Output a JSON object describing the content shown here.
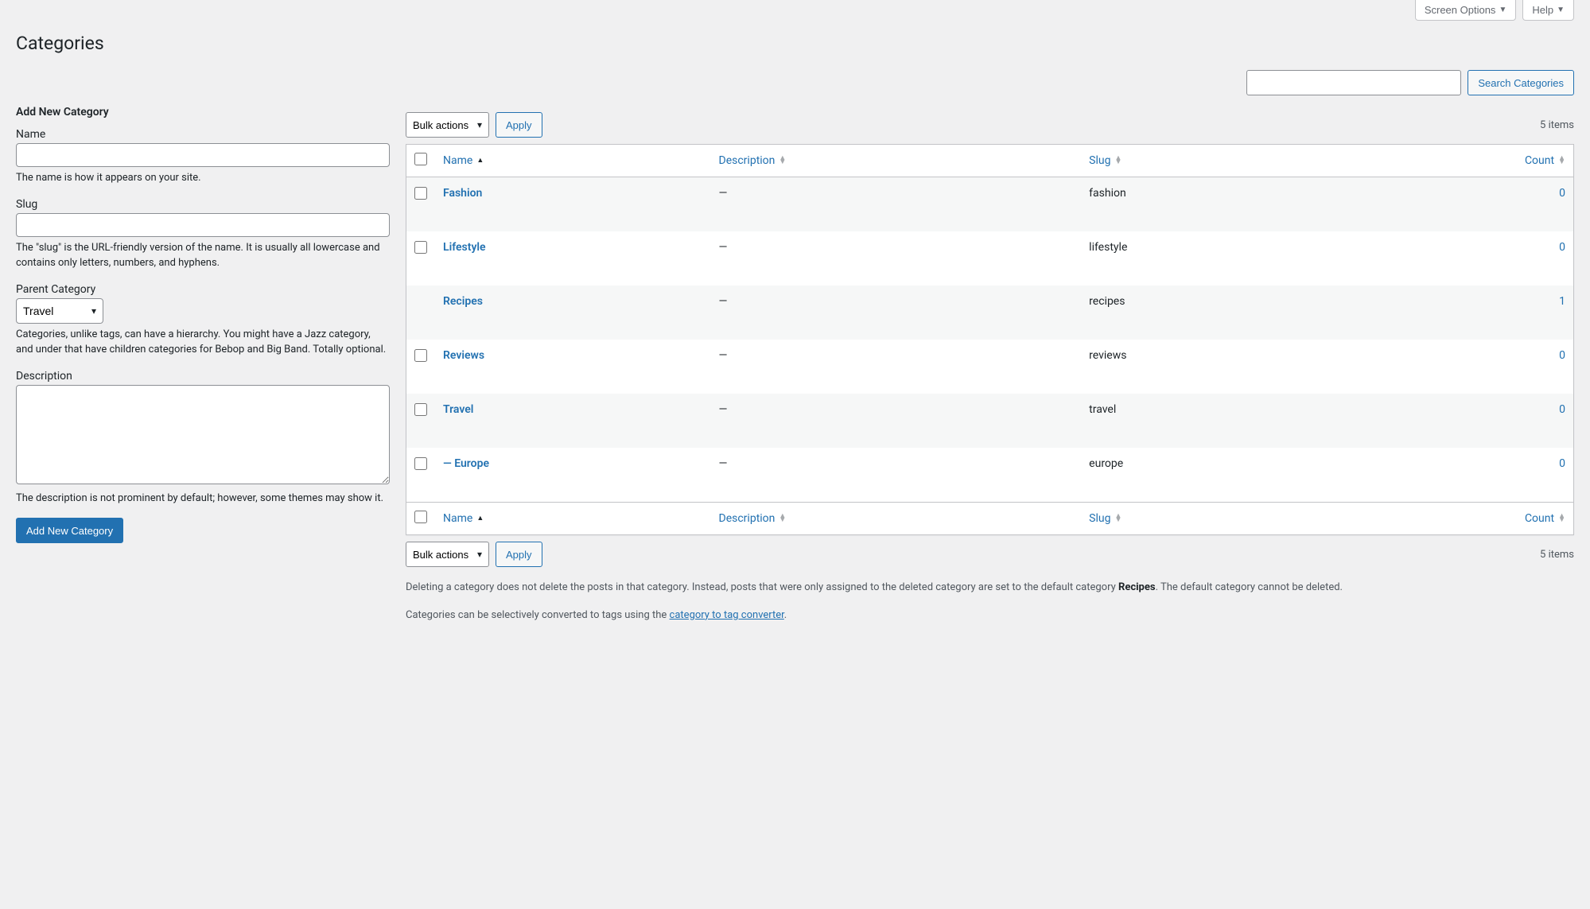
{
  "topbar": {
    "screen_options": "Screen Options",
    "help": "Help"
  },
  "page_title": "Categories",
  "search": {
    "button": "Search Categories"
  },
  "form": {
    "heading": "Add New Category",
    "name_label": "Name",
    "name_help": "The name is how it appears on your site.",
    "slug_label": "Slug",
    "slug_help": "The \"slug\" is the URL-friendly version of the name. It is usually all lowercase and contains only letters, numbers, and hyphens.",
    "parent_label": "Parent Category",
    "parent_value": "Travel",
    "parent_help": "Categories, unlike tags, can have a hierarchy. You might have a Jazz category, and under that have children categories for Bebop and Big Band. Totally optional.",
    "description_label": "Description",
    "description_help": "The description is not prominent by default; however, some themes may show it.",
    "submit": "Add New Category"
  },
  "bulk": {
    "label": "Bulk actions",
    "apply": "Apply"
  },
  "pagination": "5 items",
  "table": {
    "cols": {
      "name": "Name",
      "description": "Description",
      "slug": "Slug",
      "count": "Count"
    },
    "rows": [
      {
        "name": "Fashion",
        "description": "—",
        "slug": "fashion",
        "count": "0",
        "indent": false
      },
      {
        "name": "Lifestyle",
        "description": "—",
        "slug": "lifestyle",
        "count": "0",
        "indent": false
      },
      {
        "name": "Recipes",
        "description": "—",
        "slug": "recipes",
        "count": "1",
        "indent": false,
        "nocheck": true
      },
      {
        "name": "Reviews",
        "description": "—",
        "slug": "reviews",
        "count": "0",
        "indent": false
      },
      {
        "name": "Travel",
        "description": "—",
        "slug": "travel",
        "count": "0",
        "indent": false
      },
      {
        "name": "— Europe",
        "description": "—",
        "slug": "europe",
        "count": "0",
        "indent": false
      }
    ]
  },
  "notes": {
    "p1a": "Deleting a category does not delete the posts in that category. Instead, posts that were only assigned to the deleted category are set to the default category ",
    "p1_strong": "Recipes",
    "p1b": ". The default category cannot be deleted.",
    "p2a": "Categories can be selectively converted to tags using the ",
    "p2_link": "category to tag converter",
    "p2b": "."
  }
}
